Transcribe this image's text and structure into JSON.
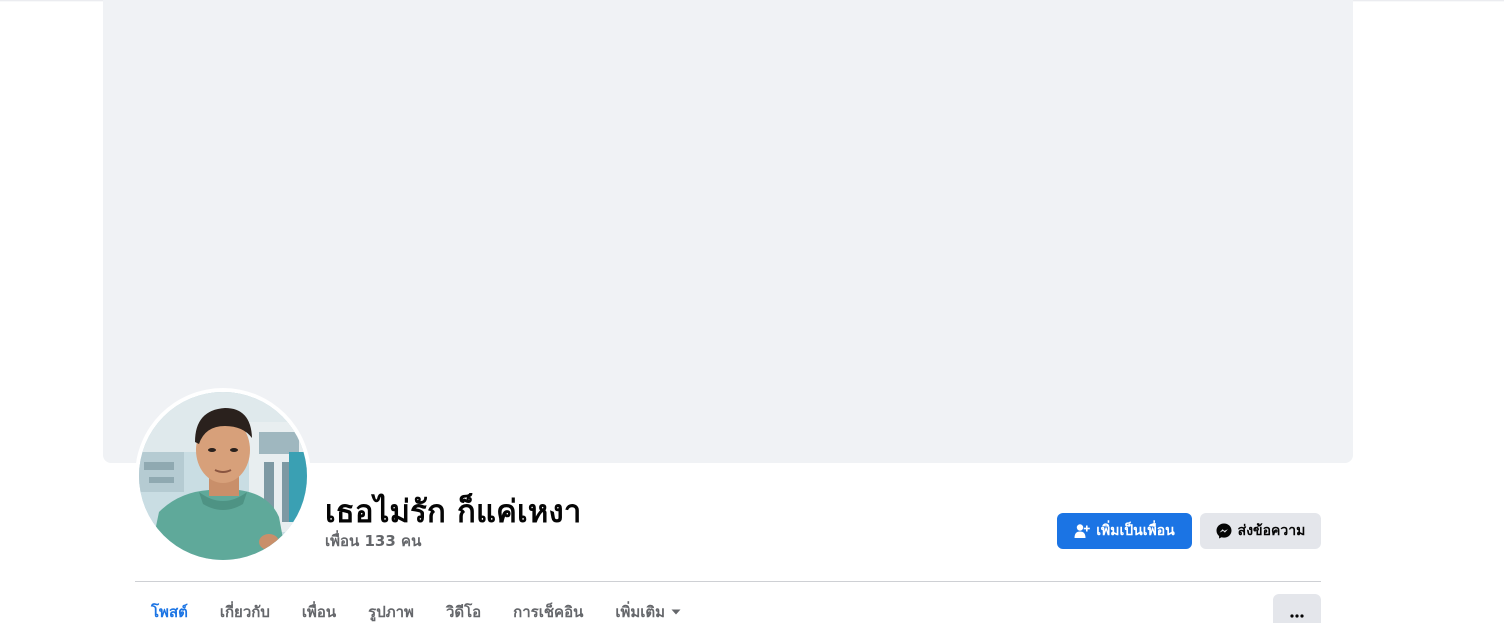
{
  "profile": {
    "name": "เธอไม่รัก ก็แค่เหงา",
    "friends_count": "เพื่อน 133 คน"
  },
  "actions": {
    "add_friend_label": "เพิ่มเป็นเพื่อน",
    "add_friend_icon": "add-friend-icon",
    "message_label": "ส่งข้อความ",
    "message_icon": "messenger-icon"
  },
  "tabs": [
    {
      "label": "โพสต์",
      "active": true
    },
    {
      "label": "เกี่ยวกับ",
      "active": false
    },
    {
      "label": "เพื่อน",
      "active": false
    },
    {
      "label": "รูปภาพ",
      "active": false
    },
    {
      "label": "วิดีโอ",
      "active": false
    },
    {
      "label": "การเช็คอิน",
      "active": false
    },
    {
      "label": "เพิ่มเติม",
      "active": false
    }
  ],
  "more_menu_icon": "more-horizontal-icon",
  "colors": {
    "accent": "#1b74e4",
    "cover_bg": "#f0f2f5",
    "secondary_button_bg": "#e4e6eb",
    "secondary_text": "#65676b"
  }
}
